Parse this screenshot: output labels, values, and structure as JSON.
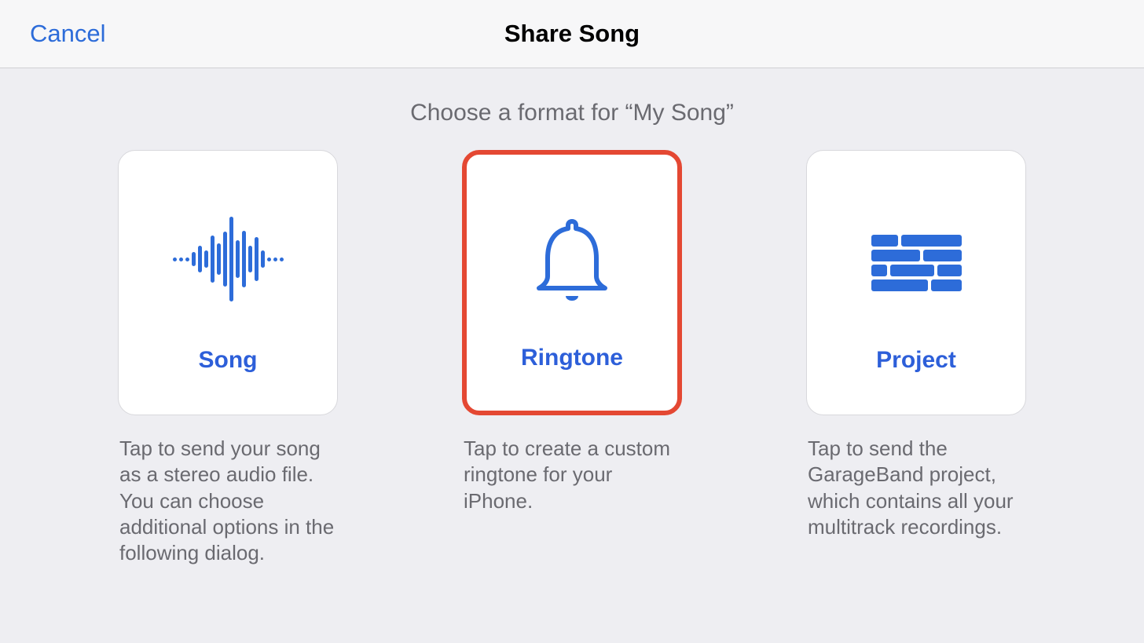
{
  "header": {
    "cancel_label": "Cancel",
    "title": "Share Song"
  },
  "subtitle": "Choose a format for “My Song”",
  "options": {
    "song": {
      "title": "Song",
      "description": "Tap to send your song as a stereo audio file. You can choose additional options in the following dialog."
    },
    "ringtone": {
      "title": "Ringtone",
      "description": "Tap to create a custom ringtone for your iPhone.",
      "selected": true
    },
    "project": {
      "title": "Project",
      "description": "Tap to send the GarageBand project, which contains all your multitrack recordings."
    }
  }
}
